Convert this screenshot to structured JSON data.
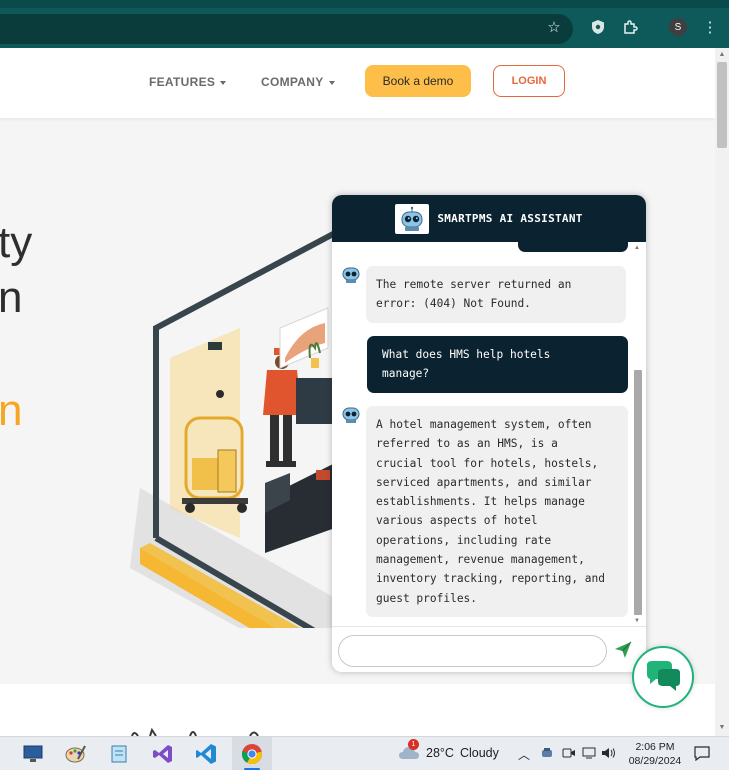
{
  "browser": {
    "profile_initial": "S",
    "icons": [
      "star-icon",
      "shield-extension-icon",
      "puzzle-extensions-icon",
      "profile-avatar",
      "kebab-menu-icon"
    ]
  },
  "nav": {
    "features": "FEATURES",
    "company": "COMPANY",
    "book_demo": "Book a demo",
    "login": "LOGIN"
  },
  "hero": {
    "fragments": [
      "ty",
      "n",
      "n"
    ]
  },
  "chat": {
    "title": "SMARTPMS AI ASSISTANT",
    "messages": [
      {
        "role": "bot",
        "text": "The remote server returned an\nerror: (404) Not Found."
      },
      {
        "role": "user",
        "text": "What does HMS help hotels\nmanage?"
      },
      {
        "role": "bot",
        "text": "A hotel management system, often\nreferred to as an HMS, is a\ncrucial tool for hotels, hostels,\nserviced apartments, and similar\nestablishments. It helps manage\nvarious aspects of hotel\noperations, including rate\nmanagement, revenue management,\ninventory tracking, reporting, and\nguest profiles."
      }
    ],
    "input_placeholder": ""
  },
  "taskbar": {
    "weather_temp": "28°C",
    "weather_text": "Cloudy",
    "weather_badge": "1",
    "time": "2:06 PM",
    "date": "08/29/2024"
  },
  "colors": {
    "brand_dark": "#0b2330",
    "demo_button": "#fdbf4a",
    "login_accent": "#e8673a",
    "launcher_green": "#20b37a",
    "chrome_teal": "#0e5a5a"
  }
}
